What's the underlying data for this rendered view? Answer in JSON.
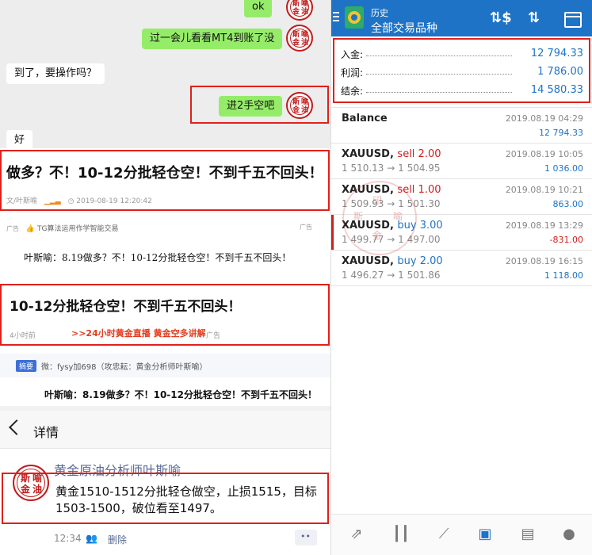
{
  "chat": {
    "msg_ok": "ok",
    "msg_check_mt4": "过一会儿看看MT4到账了没",
    "msg_arrived": "到了，要操作吗？",
    "msg_short": "进2手空吧",
    "msg_good": "好"
  },
  "seal": {
    "c1": "斯",
    "c2": "喻",
    "c3": "金",
    "c4": "油"
  },
  "article": {
    "title": "做多？不！10-12分批轻仓空！不到千五不回头！",
    "author": "文/叶斯喻",
    "date": "2019-08-19 12:20:42",
    "ad_tag": "广告",
    "ad_text": "TG算法运用作学智能交易",
    "post_line": "叶斯喻：8.19做多？不！10-12分批轻仓空！不到千五不回头！",
    "big_title": "10-12分批轻仓空！不到千五不回头！",
    "time_ago": "4小时前",
    "live_link": ">>24小时黄金直播 黄金空多讲解",
    "summary_tag": "摘要",
    "summary_text": "微：fysy加698（攻忠耘：黄金分析师叶斯喻）",
    "post_line2": "叶斯喻：8.19做多？不！10-12分批轻仓空！不到千五不回头！"
  },
  "detail": {
    "title": "详情",
    "author_name": "黄金原油分析师叶斯喻",
    "text": "黄金1510-1512分批轻仓做空，止损1515，目标1503-1500，破位看至1497。",
    "time": "12:34",
    "delete": "删除"
  },
  "mt4": {
    "header_sub": "历史",
    "header_title": "全部交易品种",
    "summary": [
      {
        "label": "入金:",
        "value": "12 794.33"
      },
      {
        "label": "利润:",
        "value": "1 786.00"
      },
      {
        "label": "结余:",
        "value": "14 580.33"
      }
    ],
    "balance": {
      "label": "Balance",
      "time": "2019.08.19 04:29",
      "value": "12 794.33"
    },
    "trades": [
      {
        "symbol": "XAUUSD,",
        "side": "sell 2.00",
        "side_type": "sell",
        "prices": "1 510.13 → 1 504.95",
        "time": "2019.08.19 10:05",
        "profit": "1 036.00"
      },
      {
        "symbol": "XAUUSD,",
        "side": "sell 1.00",
        "side_type": "sell",
        "prices": "1 509.93 → 1 501.30",
        "time": "2019.08.19 10:21",
        "profit": "863.00"
      },
      {
        "symbol": "XAUUSD,",
        "side": "buy 3.00",
        "side_type": "buy",
        "prices": "1 499.77 → 1 497.00",
        "time": "2019.08.19 13:29",
        "profit": "-831.00"
      },
      {
        "symbol": "XAUUSD,",
        "side": "buy 2.00",
        "side_type": "buy",
        "prices": "1 496.27 → 1 501.86",
        "time": "2019.08.19 16:15",
        "profit": "1 118.00"
      }
    ],
    "watermark": {
      "a": "印",
      "b": "喻",
      "c": "斯",
      "d": "金"
    }
  },
  "colors": {
    "sell": "#d21c1c",
    "buy": "#1e73c7",
    "positive": "#1e73c7",
    "negative": "#d21c1c",
    "highlight": "#e0201b"
  }
}
